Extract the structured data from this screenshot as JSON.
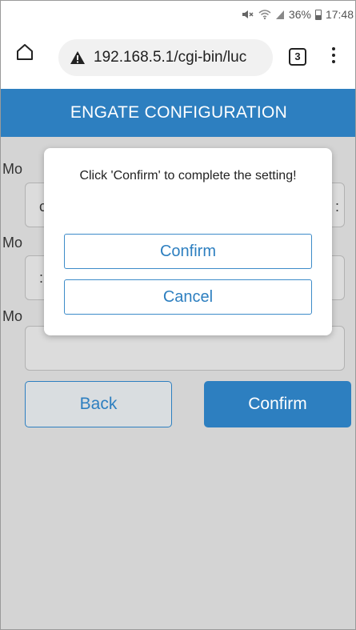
{
  "status_bar": {
    "mute_icon": "mute-icon",
    "wifi_icon": "wifi-icon",
    "signal_icon": "signal-icon",
    "battery": "36%",
    "battery_icon": "battery-icon",
    "time": "17:48"
  },
  "browser": {
    "home_icon": "home-icon",
    "warning_icon": "warning-icon",
    "url": "192.168.5.1/cgi-bin/luc",
    "tab_count": "3",
    "menu_icon": "more-vert-icon"
  },
  "page": {
    "title": "ENGATE CONFIGURATION",
    "fields": [
      {
        "label": "Mo",
        "value": "c",
        "trailing": ":"
      },
      {
        "label": "Mo",
        "value": ":"
      },
      {
        "label": "Mo",
        "value": ""
      }
    ],
    "back_label": "Back",
    "confirm_label": "Confirm"
  },
  "dialog": {
    "message": "Click 'Confirm' to complete the setting!",
    "confirm_label": "Confirm",
    "cancel_label": "Cancel"
  },
  "colors": {
    "accent": "#2d7fc0",
    "overlay": "#d4d4d4"
  }
}
